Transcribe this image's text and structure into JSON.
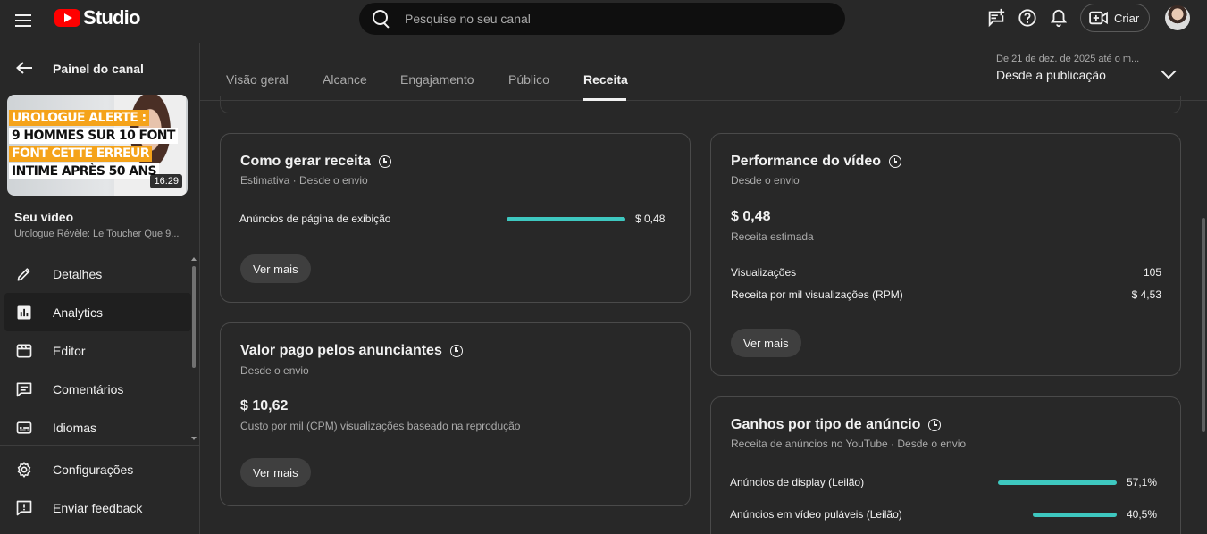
{
  "app": {
    "logo_text": "Studio"
  },
  "search": {
    "placeholder": "Pesquise no seu canal"
  },
  "header": {
    "create_label": "Criar"
  },
  "sidebar": {
    "back_label": "Painel do canal",
    "thumbnail": {
      "lines": [
        "UROLOGUE ALERTE :",
        "9 HOMMES SUR 10 FONT",
        "FONT CETTE ERREUR",
        "INTIME APRÈS 50 ANS"
      ],
      "duration": "16:29"
    },
    "your_video": "Seu vídeo",
    "video_title": "Urologue Révèle: Le Toucher Que 9...",
    "items": [
      {
        "label": "Detalhes",
        "icon": "pencil-icon"
      },
      {
        "label": "Analytics",
        "icon": "analytics-icon",
        "active": true
      },
      {
        "label": "Editor",
        "icon": "clapper-icon"
      },
      {
        "label": "Comentários",
        "icon": "comment-icon"
      },
      {
        "label": "Idiomas",
        "icon": "subtitles-icon"
      }
    ],
    "bottom_items": [
      {
        "label": "Configurações",
        "icon": "gear-icon"
      },
      {
        "label": "Enviar feedback",
        "icon": "feedback-icon"
      }
    ]
  },
  "tabs": [
    {
      "label": "Visão geral"
    },
    {
      "label": "Alcance"
    },
    {
      "label": "Engajamento"
    },
    {
      "label": "Público"
    },
    {
      "label": "Receita",
      "active": true
    }
  ],
  "date_range": {
    "sub": "De 21 de dez. de 2025 até o m...",
    "main": "Desde a publicação"
  },
  "cards": {
    "revenue_sources": {
      "title": "Como gerar receita",
      "subtitle": "Estimativa · Desde o envio",
      "rows": [
        {
          "label": "Anúncios de página de exibição",
          "value": "$ 0,48",
          "fraction": 1.0
        }
      ],
      "button": "Ver mais"
    },
    "advertiser_paid": {
      "title": "Valor pago pelos anunciantes",
      "subtitle": "Desde o envio",
      "value": "$ 10,62",
      "value_label": "Custo por mil (CPM) visualizações baseado na reprodução",
      "button": "Ver mais"
    },
    "video_performance": {
      "title": "Performance do vídeo",
      "subtitle": "Desde o envio",
      "value": "$ 0,48",
      "value_label": "Receita estimada",
      "rows": [
        {
          "label": "Visualizações",
          "value": "105"
        },
        {
          "label": "Receita por mil visualizações (RPM)",
          "value": "$ 4,53"
        }
      ],
      "button": "Ver mais"
    },
    "ad_type_earnings": {
      "title": "Ganhos por tipo de anúncio",
      "subtitle": "Receita de anúncios no YouTube · Desde o envio",
      "rows": [
        {
          "label": "Anúncios de display (Leilão)",
          "value": "57,1%",
          "fraction": 0.571
        },
        {
          "label": "Anúncios em vídeo puláveis (Leilão)",
          "value": "40,5%",
          "fraction": 0.405
        }
      ]
    }
  },
  "colors": {
    "accent_bar": "#3ec8c0",
    "brand_red": "#ff0000",
    "background": "#282828"
  }
}
